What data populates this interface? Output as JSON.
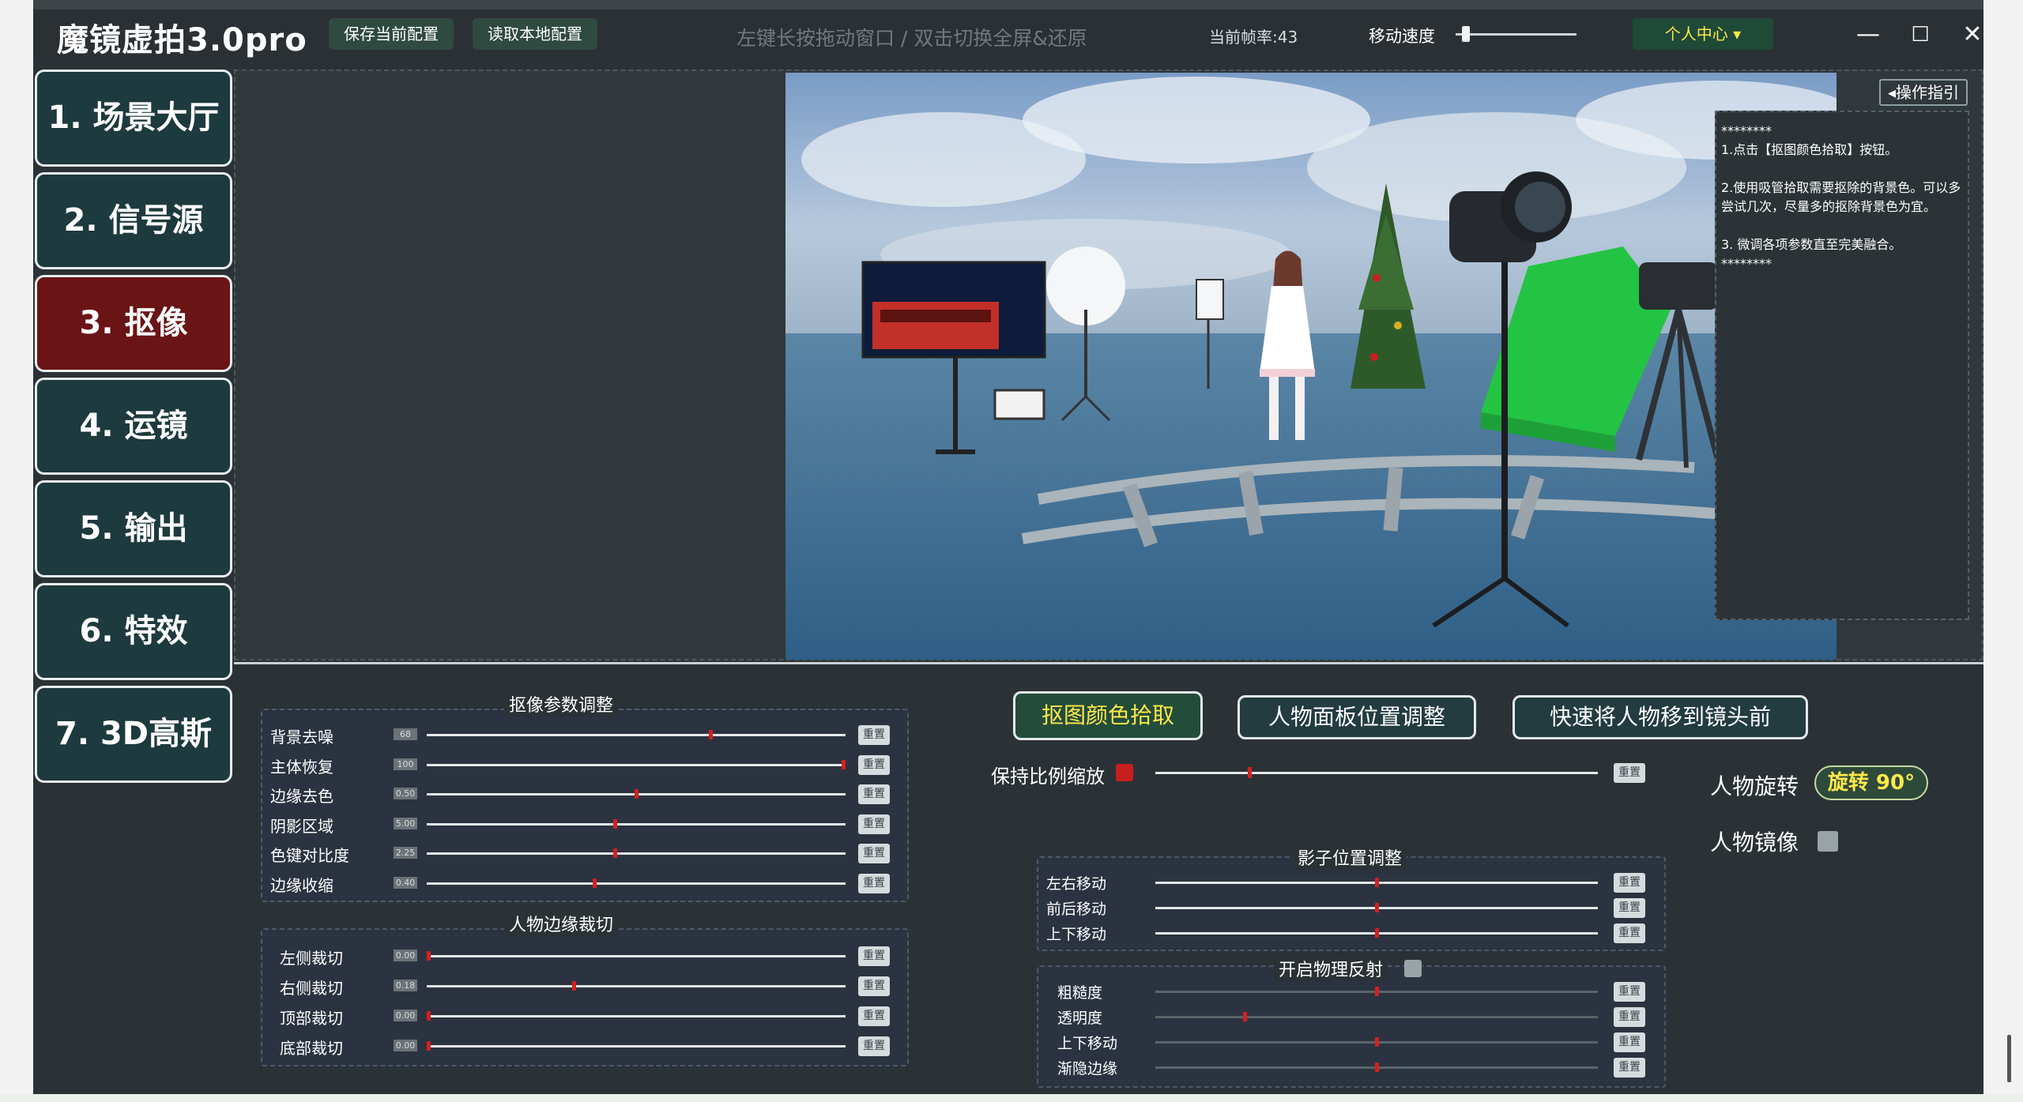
{
  "titlebar": {
    "app_title": "魔镜虚拍3.0pro",
    "save_config_label": "保存当前配置",
    "load_config_label": "读取本地配置",
    "drag_hint": "左键长按拖动窗口 / 双击切换全屏&还原",
    "fps_label": "当前帧率:43",
    "speed_label": "移动速度",
    "speed_value": 0.05,
    "user_center_label": "个人中心 ▾",
    "minimize_glyph": "—",
    "maximize_glyph": "☐",
    "close_glyph": "✕"
  },
  "nav": {
    "items": [
      {
        "label": "1. 场景大厅"
      },
      {
        "label": "2. 信号源"
      },
      {
        "label": "3. 抠像",
        "active": true
      },
      {
        "label": "4. 运镜"
      },
      {
        "label": "5. 输出"
      },
      {
        "label": "6. 特效"
      },
      {
        "label": "7. 3D高斯"
      }
    ]
  },
  "guide": {
    "button_label": "◂操作指引",
    "stars_top": "********",
    "step1": "1.点击【抠图颜色拾取】按钮。",
    "step2": "2.使用吸管拾取需要抠除的背景色。可以多尝试几次，尽量多的抠除背景色为宜。",
    "step3": "3. 微调各项参数直至完美融合。",
    "stars_bottom": "********"
  },
  "keying_panel": {
    "title": "抠像参数调整",
    "reset_label": "重置",
    "rows": [
      {
        "label": "背景去噪",
        "value": "68",
        "pos": 0.68
      },
      {
        "label": "主体恢复",
        "value": "100",
        "pos": 1.0
      },
      {
        "label": "边缘去色",
        "value": "0.50",
        "pos": 0.5
      },
      {
        "label": "阴影区域",
        "value": "5.00",
        "pos": 0.45
      },
      {
        "label": "色键对比度",
        "value": "2.25",
        "pos": 0.45
      },
      {
        "label": "边缘收缩",
        "value": "0.40",
        "pos": 0.4
      }
    ]
  },
  "crop_panel": {
    "title": "人物边缘裁切",
    "reset_label": "重置",
    "rows": [
      {
        "label": "左侧裁切",
        "value": "0.00",
        "pos": 0.0
      },
      {
        "label": "右侧裁切",
        "value": "0.18",
        "pos": 0.35
      },
      {
        "label": "顶部裁切",
        "value": "0.00",
        "pos": 0.0
      },
      {
        "label": "底部裁切",
        "value": "0.00",
        "pos": 0.0
      }
    ]
  },
  "actions": {
    "pick_color": "抠图颜色拾取",
    "panel_position": "人物面板位置调整",
    "move_front": "快速将人物移到镜头前"
  },
  "scale": {
    "label": "保持比例缩放",
    "checked": true,
    "pos": 0.21,
    "reset_label": "重置"
  },
  "shadow_panel": {
    "title": "影子位置调整",
    "reset_label": "重置",
    "rows": [
      {
        "label": "左右移动",
        "pos": 0.5
      },
      {
        "label": "前后移动",
        "pos": 0.5
      },
      {
        "label": "上下移动",
        "pos": 0.5
      }
    ]
  },
  "reflect_panel": {
    "title": "开启物理反射",
    "checked": false,
    "reset_label": "重置",
    "rows": [
      {
        "label": "粗糙度",
        "pos": 0.5
      },
      {
        "label": "透明度",
        "pos": 0.2
      },
      {
        "label": "上下移动",
        "pos": 0.5
      },
      {
        "label": "渐隐边缘",
        "pos": 0.5
      }
    ]
  },
  "right_controls": {
    "rotate_label": "人物旋转",
    "rotate_value": "旋转 90°",
    "mirror_label": "人物镜像",
    "mirror_checked": false
  },
  "colors": {
    "active_nav": "#6a1416",
    "nav": "#1d3a3e",
    "accent_yellow": "#ffe84a",
    "slider_knob": "#d42020"
  }
}
